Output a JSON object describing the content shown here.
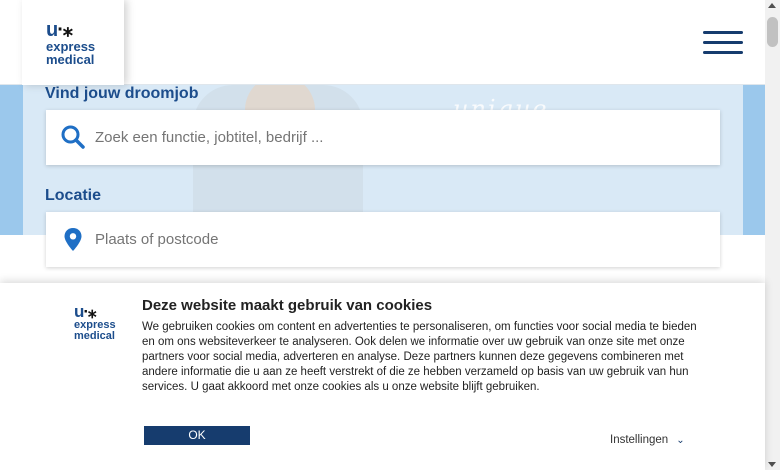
{
  "header": {
    "logo": {
      "mark": "u",
      "tagline_1": "express",
      "tagline_2": "medical"
    },
    "menu_icon": "hamburger-menu-icon"
  },
  "hero": {
    "script_text": "unique",
    "job_label": "Vind jouw droomjob",
    "job_placeholder": "Zoek een functie, jobtitel, bedrijf ...",
    "location_label": "Locatie",
    "location_placeholder": "Plaats of postcode"
  },
  "cookie": {
    "logo": {
      "mark": "u",
      "tagline_1": "express",
      "tagline_2": "medical"
    },
    "title": "Deze website maakt gebruik van cookies",
    "body": "We gebruiken cookies om content en advertenties te personaliseren, om functies voor social media te bieden en om ons websiteverkeer te analyseren. Ook delen we informatie over uw gebruik van onze site met onze partners voor social media, adverteren en analyse. Deze partners kunnen deze gegevens combineren met andere informatie die u aan ze heeft verstrekt of die ze hebben verzameld op basis van uw gebruik van hun services. U gaat akkoord met onze cookies als u onze website blijft gebruiken.",
    "ok_label": "OK",
    "settings_label": "Instellingen"
  },
  "colors": {
    "brand_blue": "#1c4d8c",
    "dark_blue": "#163c6e",
    "hero_blue": "#9bc8ec"
  }
}
